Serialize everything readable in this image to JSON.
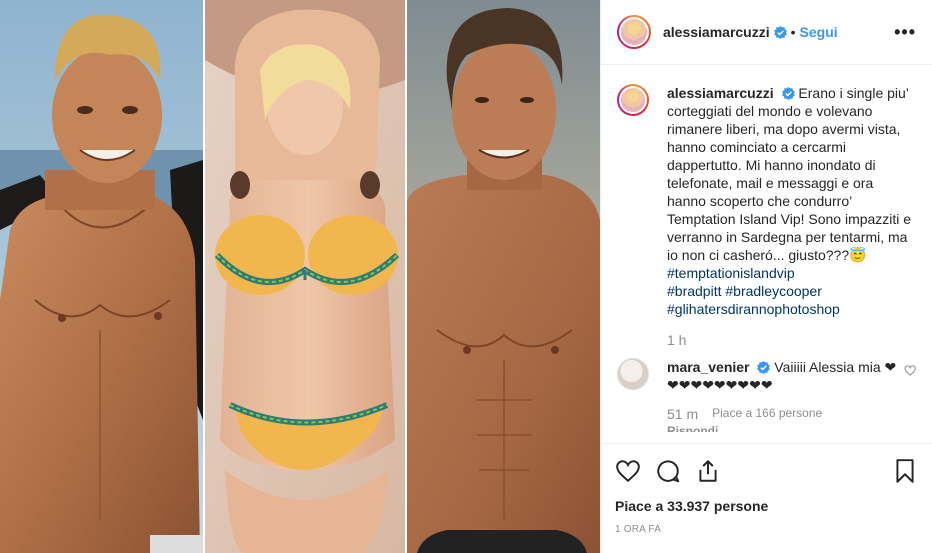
{
  "post": {
    "username": "alessiamarcuzzi",
    "follow_label": "Segui",
    "more_label": "•••",
    "dot_separator": "•"
  },
  "caption": {
    "username": "alessiamarcuzzi",
    "text": "Erano i single piu’ corteggiati del mondo e volevano rimanere liberi, ma dopo avermi vista, hanno cominciato a cercarmi dappertutto. Mi hanno inondato di telefonate, mail e messaggi e ora hanno scoperto che condurro’ Temptation Island Vip! Sono impazziti e verranno in Sardegna per tentarmi, ma io non ci casheró... giusto???😇",
    "hashtags": [
      "#temptationislandvip",
      "#bradpitt #bradleycooper",
      "#glihatersdirannophotoshop"
    ],
    "time": "1 h"
  },
  "comment": {
    "username": "mara_venier",
    "text": "Vaiiiii Alessia mia ❤❤❤❤❤❤❤❤❤❤",
    "time": "51 m",
    "likes": "Piace a 166 persone",
    "reply": "Rispondi"
  },
  "footer": {
    "likes": "Piace a 33.937 persone",
    "timestamp": "1 ORA FA"
  },
  "colors": {
    "link": "#3897f0",
    "hashtag": "#003569",
    "muted": "#8e8e8e"
  }
}
